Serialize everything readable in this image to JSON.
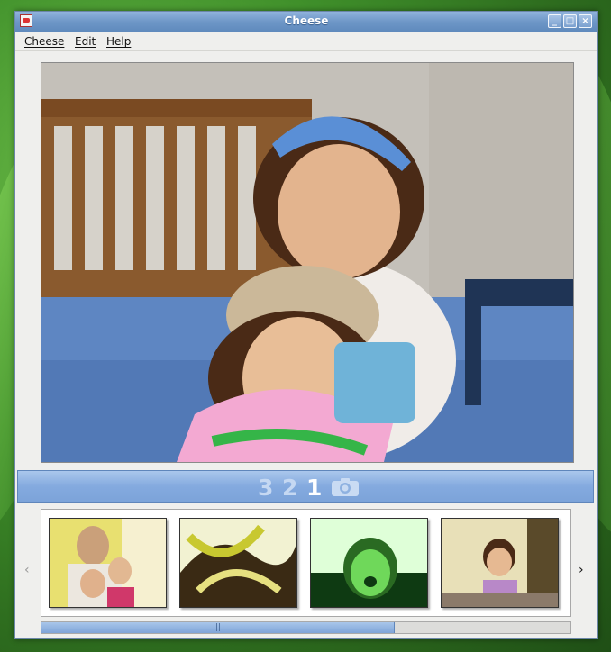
{
  "window": {
    "title": "Cheese"
  },
  "menu": {
    "items": [
      "Cheese",
      "Edit",
      "Help"
    ]
  },
  "countdown": {
    "numbers": [
      "3",
      "2",
      "1"
    ]
  },
  "icons": {
    "app": "cheese-app-icon",
    "minimize": "minimize-icon",
    "maximize": "maximize-icon",
    "close": "close-icon",
    "camera": "camera-icon",
    "prev": "chevron-left-icon",
    "next": "chevron-right-icon"
  },
  "glyphs": {
    "prev": "‹",
    "next": "›",
    "grip": "|||",
    "minimize": "_",
    "maximize": "□",
    "close": "×"
  },
  "colors": {
    "titlebar": "#6e97c7",
    "countdown_bar": "#84aadf",
    "scroll_thumb": "#7ea4d8"
  }
}
